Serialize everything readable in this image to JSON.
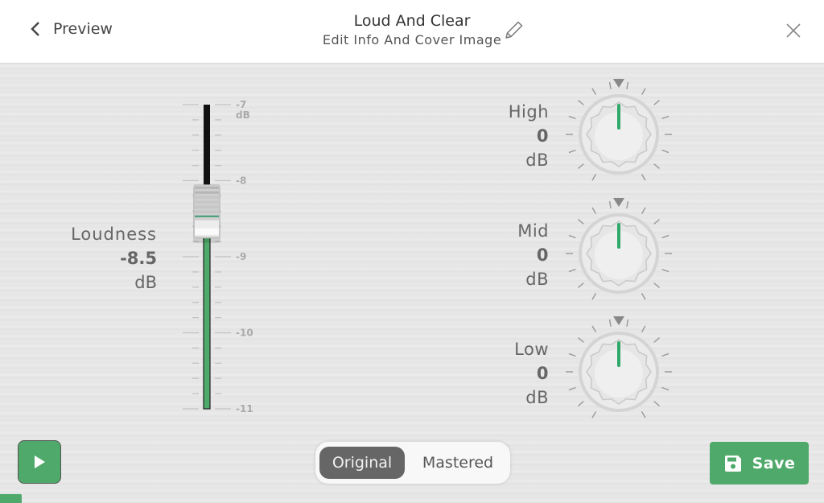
{
  "header": {
    "back_label": "Preview",
    "title": "Loud And Clear",
    "subtitle": "Edit Info And Cover Image",
    "icons": {
      "back": "chevron-left-icon",
      "edit": "pencil-icon",
      "close": "close-icon"
    }
  },
  "loudness": {
    "label": "Loudness",
    "value": "-8.5",
    "unit": "dB",
    "value_num": -8.5,
    "scale_max": -7,
    "scale_min": -11,
    "scale_labels": [
      {
        "value": -7,
        "text": "-7",
        "sub": "dB"
      },
      {
        "value": -8,
        "text": "-8",
        "sub": ""
      },
      {
        "value": -9,
        "text": "-9",
        "sub": ""
      },
      {
        "value": -10,
        "text": "-10",
        "sub": ""
      },
      {
        "value": -11,
        "text": "-11",
        "sub": ""
      }
    ]
  },
  "eq": [
    {
      "name": "High",
      "value": "0",
      "unit": "dB",
      "value_num": 0
    },
    {
      "name": "Mid",
      "value": "0",
      "unit": "dB",
      "value_num": 0
    },
    {
      "name": "Low",
      "value": "0",
      "unit": "dB",
      "value_num": 0
    }
  ],
  "playback": {
    "icon": "play-icon",
    "progress": 0.026
  },
  "toggle": {
    "options": [
      "Original",
      "Mastered"
    ],
    "selected": "Original"
  },
  "save": {
    "label": "Save",
    "icon": "floppy-disk-icon"
  },
  "colors": {
    "accent": "#4fa96a",
    "indicator": "#2fa86a",
    "selected_segment": "#666666"
  }
}
